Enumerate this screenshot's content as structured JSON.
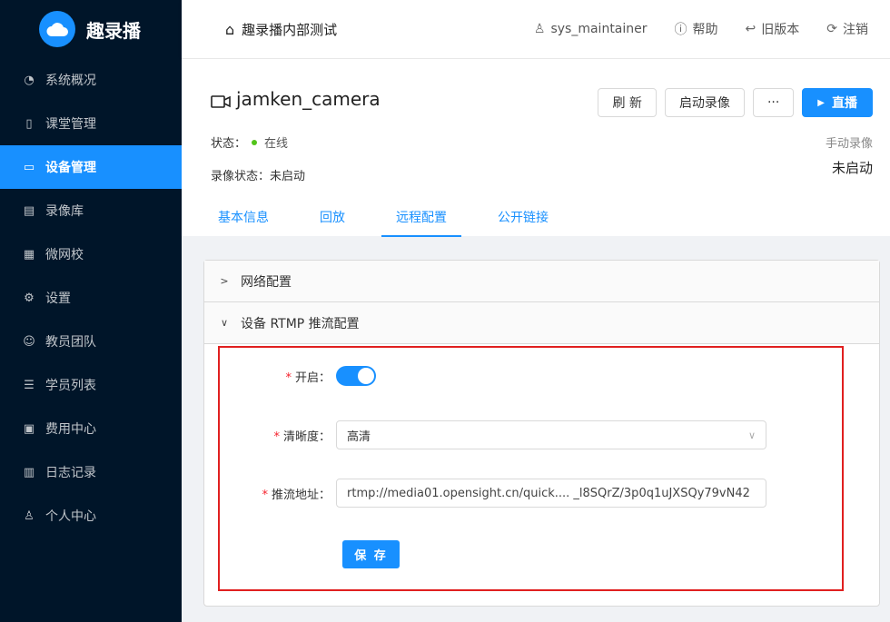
{
  "app": {
    "name": "趣录播"
  },
  "sidebar": {
    "items": [
      {
        "label": "系统概况",
        "icon": "dashboard-icon"
      },
      {
        "label": "课堂管理",
        "icon": "book-icon"
      },
      {
        "label": "设备管理",
        "icon": "camera-icon",
        "active": true
      },
      {
        "label": "录像库",
        "icon": "video-library-icon"
      },
      {
        "label": "微网校",
        "icon": "school-icon"
      },
      {
        "label": "设置",
        "icon": "gear-icon"
      },
      {
        "label": "教员团队",
        "icon": "team-icon"
      },
      {
        "label": "学员列表",
        "icon": "list-icon"
      },
      {
        "label": "费用中心",
        "icon": "wallet-icon"
      },
      {
        "label": "日志记录",
        "icon": "log-icon"
      },
      {
        "label": "个人中心",
        "icon": "user-icon"
      }
    ]
  },
  "header": {
    "org_name": "趣录播内部测试",
    "user": "sys_maintainer",
    "help": "帮助",
    "old_version": "旧版本",
    "logout": "注销"
  },
  "device": {
    "name": "jamken_camera",
    "status_label": "状态：",
    "status_value": "在线",
    "status_color": "#52c41a",
    "record_status_label": "录像状态：",
    "record_status_value": "未启动",
    "manual_record_label": "手动录像",
    "manual_record_value": "未启动"
  },
  "actions": {
    "refresh": "刷 新",
    "start_record": "启动录像",
    "more": "···",
    "live": "直播"
  },
  "tabs": [
    {
      "label": "基本信息"
    },
    {
      "label": "回放"
    },
    {
      "label": "远程配置",
      "active": true
    },
    {
      "label": "公开链接"
    }
  ],
  "panels": {
    "network": {
      "title": "网络配置",
      "expanded": false
    },
    "rtmp": {
      "title": "设备 RTMP 推流配置",
      "expanded": true
    }
  },
  "form": {
    "enable_label": "开启：",
    "enable_value": true,
    "quality_label": "清晰度：",
    "quality_value": "高清",
    "push_url_label": "推流地址：",
    "push_url_value": "rtmp://media01.opensight.cn/quick.... _l8SQrZ/3p0q1uJXSQy79vN42",
    "save_label": "保 存"
  },
  "colors": {
    "primary": "#1890ff",
    "sidebar_bg": "#001529",
    "highlight_border": "#e02020"
  }
}
